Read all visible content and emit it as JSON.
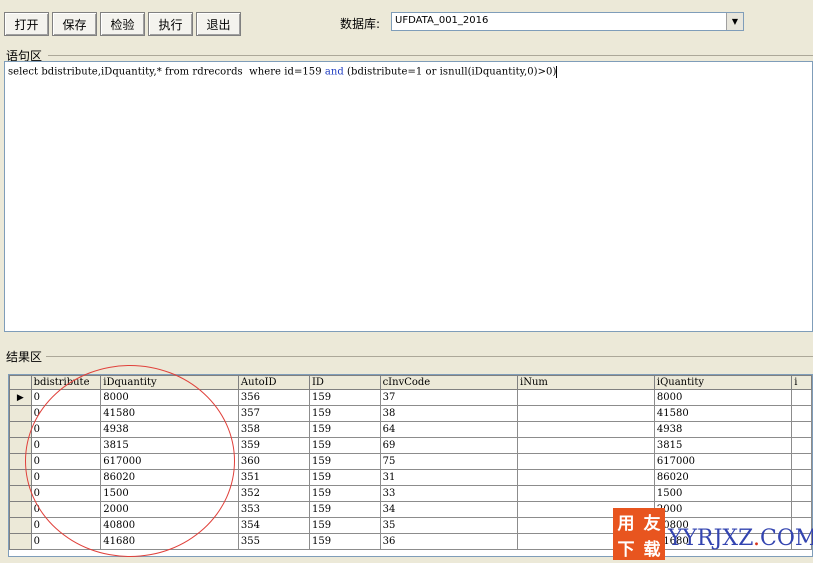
{
  "toolbar": {
    "open_label": "打开",
    "save_label": "保存",
    "check_label": "检验",
    "execute_label": "执行",
    "exit_label": "退出"
  },
  "database": {
    "label": "数据库:",
    "value": "UFDATA_001_2016"
  },
  "query_group": {
    "label": "语句区",
    "sql_pre": "select bdistribute,iDquantity,* from rdrecords  where id=159 ",
    "sql_kw": "and",
    "sql_post": " (bdistribute=1 or isnull(iDquantity,0)>0)"
  },
  "results_group": {
    "label": "结果区",
    "columns": [
      "bdistribute",
      "iDquantity",
      "AutoID",
      "ID",
      "cInvCode",
      "iNum",
      "iQuantity",
      "i"
    ],
    "rows": [
      [
        "0",
        "8000",
        "356",
        "159",
        "37",
        "",
        "8000"
      ],
      [
        "0",
        "41580",
        "357",
        "159",
        "38",
        "",
        "41580"
      ],
      [
        "0",
        "4938",
        "358",
        "159",
        "64",
        "",
        "4938"
      ],
      [
        "0",
        "3815",
        "359",
        "159",
        "69",
        "",
        "3815"
      ],
      [
        "0",
        "617000",
        "360",
        "159",
        "75",
        "",
        "617000"
      ],
      [
        "0",
        "86020",
        "351",
        "159",
        "31",
        "",
        "86020"
      ],
      [
        "0",
        "1500",
        "352",
        "159",
        "33",
        "",
        "1500"
      ],
      [
        "0",
        "2000",
        "353",
        "159",
        "34",
        "",
        "2000"
      ],
      [
        "0",
        "40800",
        "354",
        "159",
        "35",
        "",
        "40800"
      ],
      [
        "0",
        "41680",
        "355",
        "159",
        "36",
        "",
        "41680"
      ]
    ],
    "current_row_marker": "▶"
  },
  "watermark": {
    "chars": [
      "用",
      "友",
      "下",
      "载"
    ],
    "url_main": "YYRJXZ",
    "url_dot": ".",
    "url_tld": "COM"
  },
  "colors": {
    "annotation_circle": "#e0413b",
    "watermark_box": "#e8551f",
    "watermark_text": "#3344b0"
  }
}
